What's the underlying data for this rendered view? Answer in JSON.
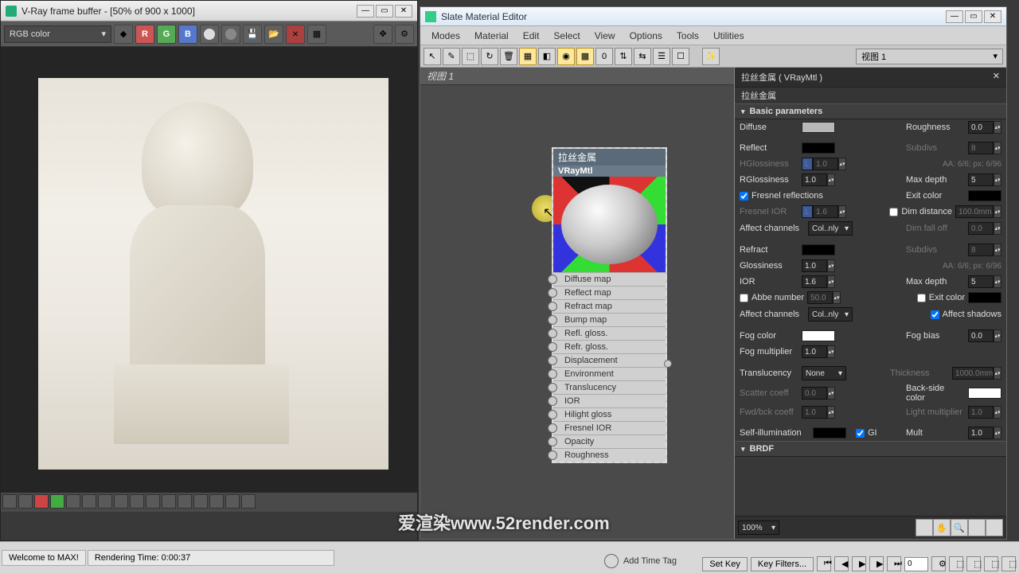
{
  "vfb": {
    "title": "V-Ray frame buffer - [50% of 900 x 1000]",
    "channel": "RGB color",
    "bottomIcons": 16
  },
  "status": {
    "welcome": "Welcome to MAX!",
    "renderTime": "Rendering Time: 0:00:37"
  },
  "slate": {
    "title": "Slate Material Editor",
    "menu": [
      "Modes",
      "Material",
      "Edit",
      "Select",
      "View",
      "Options",
      "Tools",
      "Utilities"
    ],
    "viewTab": "视图 1",
    "viewCombo": "视图 1"
  },
  "node": {
    "name": "拉丝金属",
    "type": "VRayMtl",
    "slots": [
      "Diffuse map",
      "Reflect map",
      "Refract map",
      "Bump map",
      "Refl. gloss.",
      "Refr. gloss.",
      "Displacement",
      "Environment",
      "Translucency",
      "IOR",
      "Hilight gloss",
      "Fresnel IOR",
      "Opacity",
      "Roughness"
    ]
  },
  "props": {
    "mtlId": "拉丝金属  ( VRayMtl )",
    "mtlName": "拉丝金属",
    "rollup1": "Basic parameters",
    "diffuse": {
      "label": "Diffuse",
      "swatch": "#b8b8b8",
      "roughLabel": "Roughness",
      "rough": "0.0"
    },
    "reflect": {
      "label": "Reflect",
      "swatch": "#000000",
      "subdivLabel": "Subdivs",
      "subdiv": "8",
      "hglossLabel": "HGlossiness",
      "hgloss": "1.0",
      "aa": "AA: 6/6; px: 6/96",
      "rglossLabel": "RGlossiness",
      "rgloss": "1.0",
      "maxdepthLabel": "Max depth",
      "maxdepth": "5",
      "fresnel": "Fresnel reflections",
      "exitLabel": "Exit color",
      "exitSwatch": "#000000",
      "iorLabel": "Fresnel IOR",
      "ior": "1.6",
      "dimLabel": "Dim distance",
      "dim": "100.0mm",
      "affect": "Affect channels",
      "affectVal": "Col..nly",
      "falloffLabel": "Dim fall off",
      "falloff": "0.0"
    },
    "refract": {
      "label": "Refract",
      "swatch": "#000000",
      "subdivLabel": "Subdivs",
      "subdiv": "8",
      "glossLabel": "Glossiness",
      "gloss": "1.0",
      "aa": "AA: 6/6; px: 6/96",
      "iorLabel": "IOR",
      "ior": "1.6",
      "maxdepthLabel": "Max depth",
      "maxdepth": "5",
      "abbeLabel": "Abbe number",
      "abbe": "50.0",
      "exitLabel": "Exit color",
      "exitSwatch": "#000000",
      "affect": "Affect channels",
      "affectVal": "Col..nly",
      "shadows": "Affect shadows"
    },
    "fog": {
      "colorLabel": "Fog color",
      "swatch": "#ffffff",
      "biasLabel": "Fog bias",
      "bias": "0.0",
      "multLabel": "Fog multiplier",
      "mult": "1.0"
    },
    "trans": {
      "label": "Translucency",
      "val": "None",
      "thickLabel": "Thickness",
      "thick": "1000.0mm",
      "scatLabel": "Scatter coeff",
      "scat": "0.0",
      "backLabel": "Back-side color",
      "backSwatch": "#ffffff",
      "fbLabel": "Fwd/bck coeff",
      "fb": "1.0",
      "lightLabel": "Light multiplier",
      "light": "1.0"
    },
    "selfillum": {
      "label": "Self-illumination",
      "swatch": "#000000",
      "gi": "GI",
      "multLabel": "Mult",
      "mult": "1.0"
    },
    "brdf": "BRDF",
    "footer": "100%"
  },
  "timeline": {
    "tag": "Add Time Tag",
    "setKey": "Set Key",
    "keyFilters": "Key Filters...",
    "frame": "0"
  },
  "watermark": "爱渲染www.52render.com"
}
